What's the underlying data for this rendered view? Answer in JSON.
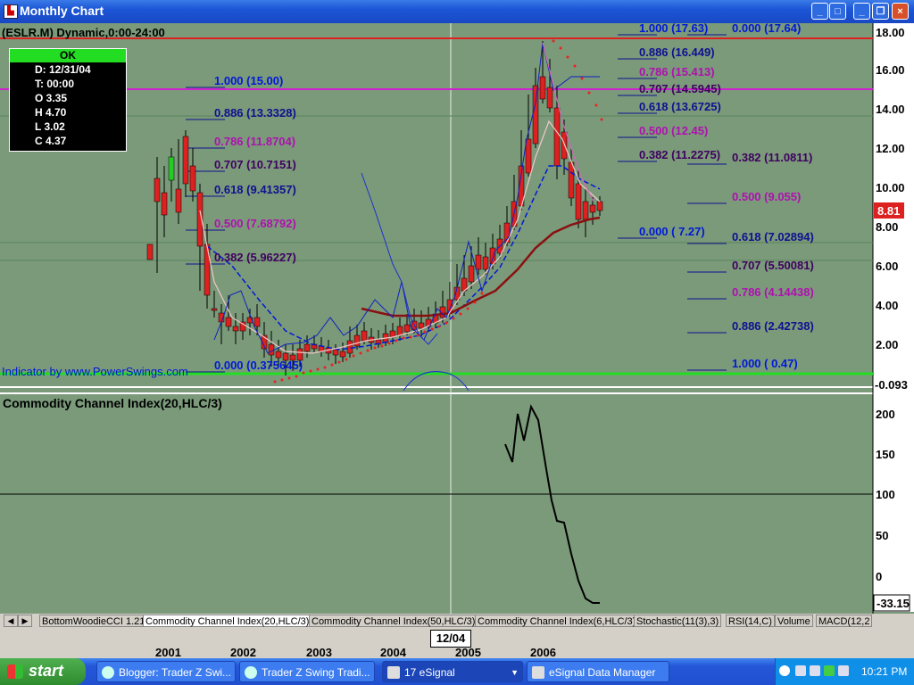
{
  "window": {
    "title": "Monthly Chart",
    "buttons": [
      "_",
      "□",
      "×"
    ],
    "mdi_buttons": [
      "_",
      "❐",
      "×"
    ]
  },
  "chart": {
    "symbol_label": "(ESLR.M) Dynamic,0:00-24:00",
    "data_window": {
      "status": "OK",
      "rows": [
        "D: 12/31/04",
        "T: 00:00",
        "O  3.35",
        "H  4.70",
        "L  3.02",
        "C  4.37"
      ]
    },
    "indicator_credit": "Indicator by www.PowerSwings.com",
    "price_axis": [
      "18.00",
      "16.00",
      "14.00",
      "12.00",
      "10.00",
      "8.00",
      "6.00",
      "4.00",
      "2.00"
    ],
    "last_price": "8.81",
    "lower_cut_value": "-0.093",
    "fib_left": [
      {
        "label": "1.000 (15.00)",
        "color": "#0018d8"
      },
      {
        "label": "0.886 (13.3328)",
        "color": "#101090"
      },
      {
        "label": "0.786 (11.8704)",
        "color": "#b010b0"
      },
      {
        "label": "0.707 (10.7151)",
        "color": "#400060"
      },
      {
        "label": "0.618 (9.41357)",
        "color": "#101090"
      },
      {
        "label": "0.500 (7.68792)",
        "color": "#b010b0"
      },
      {
        "label": "0.382 (5.96227)",
        "color": "#400060"
      },
      {
        "label": "0.000 (0.375645)",
        "color": "#0018d8"
      }
    ],
    "fib_mid": [
      {
        "label": "1.000 (17.63)",
        "color": "#0018d8"
      },
      {
        "label": "0.886 (16.449)",
        "color": "#101090"
      },
      {
        "label": "0.786 (15.413)",
        "color": "#b010b0"
      },
      {
        "label": "0.707 (14.5945)",
        "color": "#400060"
      },
      {
        "label": "0.618 (13.6725)",
        "color": "#101090"
      },
      {
        "label": "0.500 (12.45)",
        "color": "#b010b0"
      },
      {
        "label": "0.382 (11.2275)",
        "color": "#400060"
      },
      {
        "label": "0.000 ( 7.27)",
        "color": "#0018d8"
      }
    ],
    "fib_right": [
      {
        "label": "0.000 (17.64)",
        "color": "#0018d8"
      },
      {
        "label": "0.382 (11.0811)",
        "color": "#400060"
      },
      {
        "label": "0.500 (9.055)",
        "color": "#b010b0"
      },
      {
        "label": "0.618 (7.02894)",
        "color": "#101090"
      },
      {
        "label": "0.707 (5.50081)",
        "color": "#400060"
      },
      {
        "label": "0.786 (4.14438)",
        "color": "#b010b0"
      },
      {
        "label": "0.886 (2.42738)",
        "color": "#101090"
      },
      {
        "label": "1.000 ( 0.47)",
        "color": "#0018d8"
      }
    ]
  },
  "cci_pane": {
    "title": "Commodity Channel Index(20,HLC/3)",
    "axis": [
      "200",
      "150",
      "100",
      "50",
      "0"
    ],
    "last_value": "-33.15"
  },
  "tabs": [
    "BottomWoodieCCI 1.21",
    "Commodity Channel Index(20,HLC/3)",
    "Commodity Channel Index(50,HLC/3)",
    "Commodity Channel Index(6,HLC/3)",
    "Stochastic(11(3),3)",
    "RSI(14,C)",
    "Volume",
    "MACD(12,2"
  ],
  "time_axis": {
    "years": [
      "2001",
      "2002",
      "2003",
      "2004",
      "2005",
      "2006"
    ],
    "cursor_label": "12/04"
  },
  "taskbar": {
    "start_label": "start",
    "tasks": [
      {
        "label": "Blogger: Trader Z Swi...",
        "active": false
      },
      {
        "label": "Trader Z Swing Tradi...",
        "active": false
      },
      {
        "label": "17 eSignal",
        "active": true
      },
      {
        "label": "eSignal Data Manager",
        "active": false
      }
    ],
    "clock": "10:21 PM"
  },
  "colors": {
    "chart_bg": "#7a9a7a",
    "up_candle": "#22cc22",
    "down_candle": "#dd2020",
    "resistance": "#dd2020",
    "fib_line": "#d020d0",
    "support": "#20dd20"
  }
}
